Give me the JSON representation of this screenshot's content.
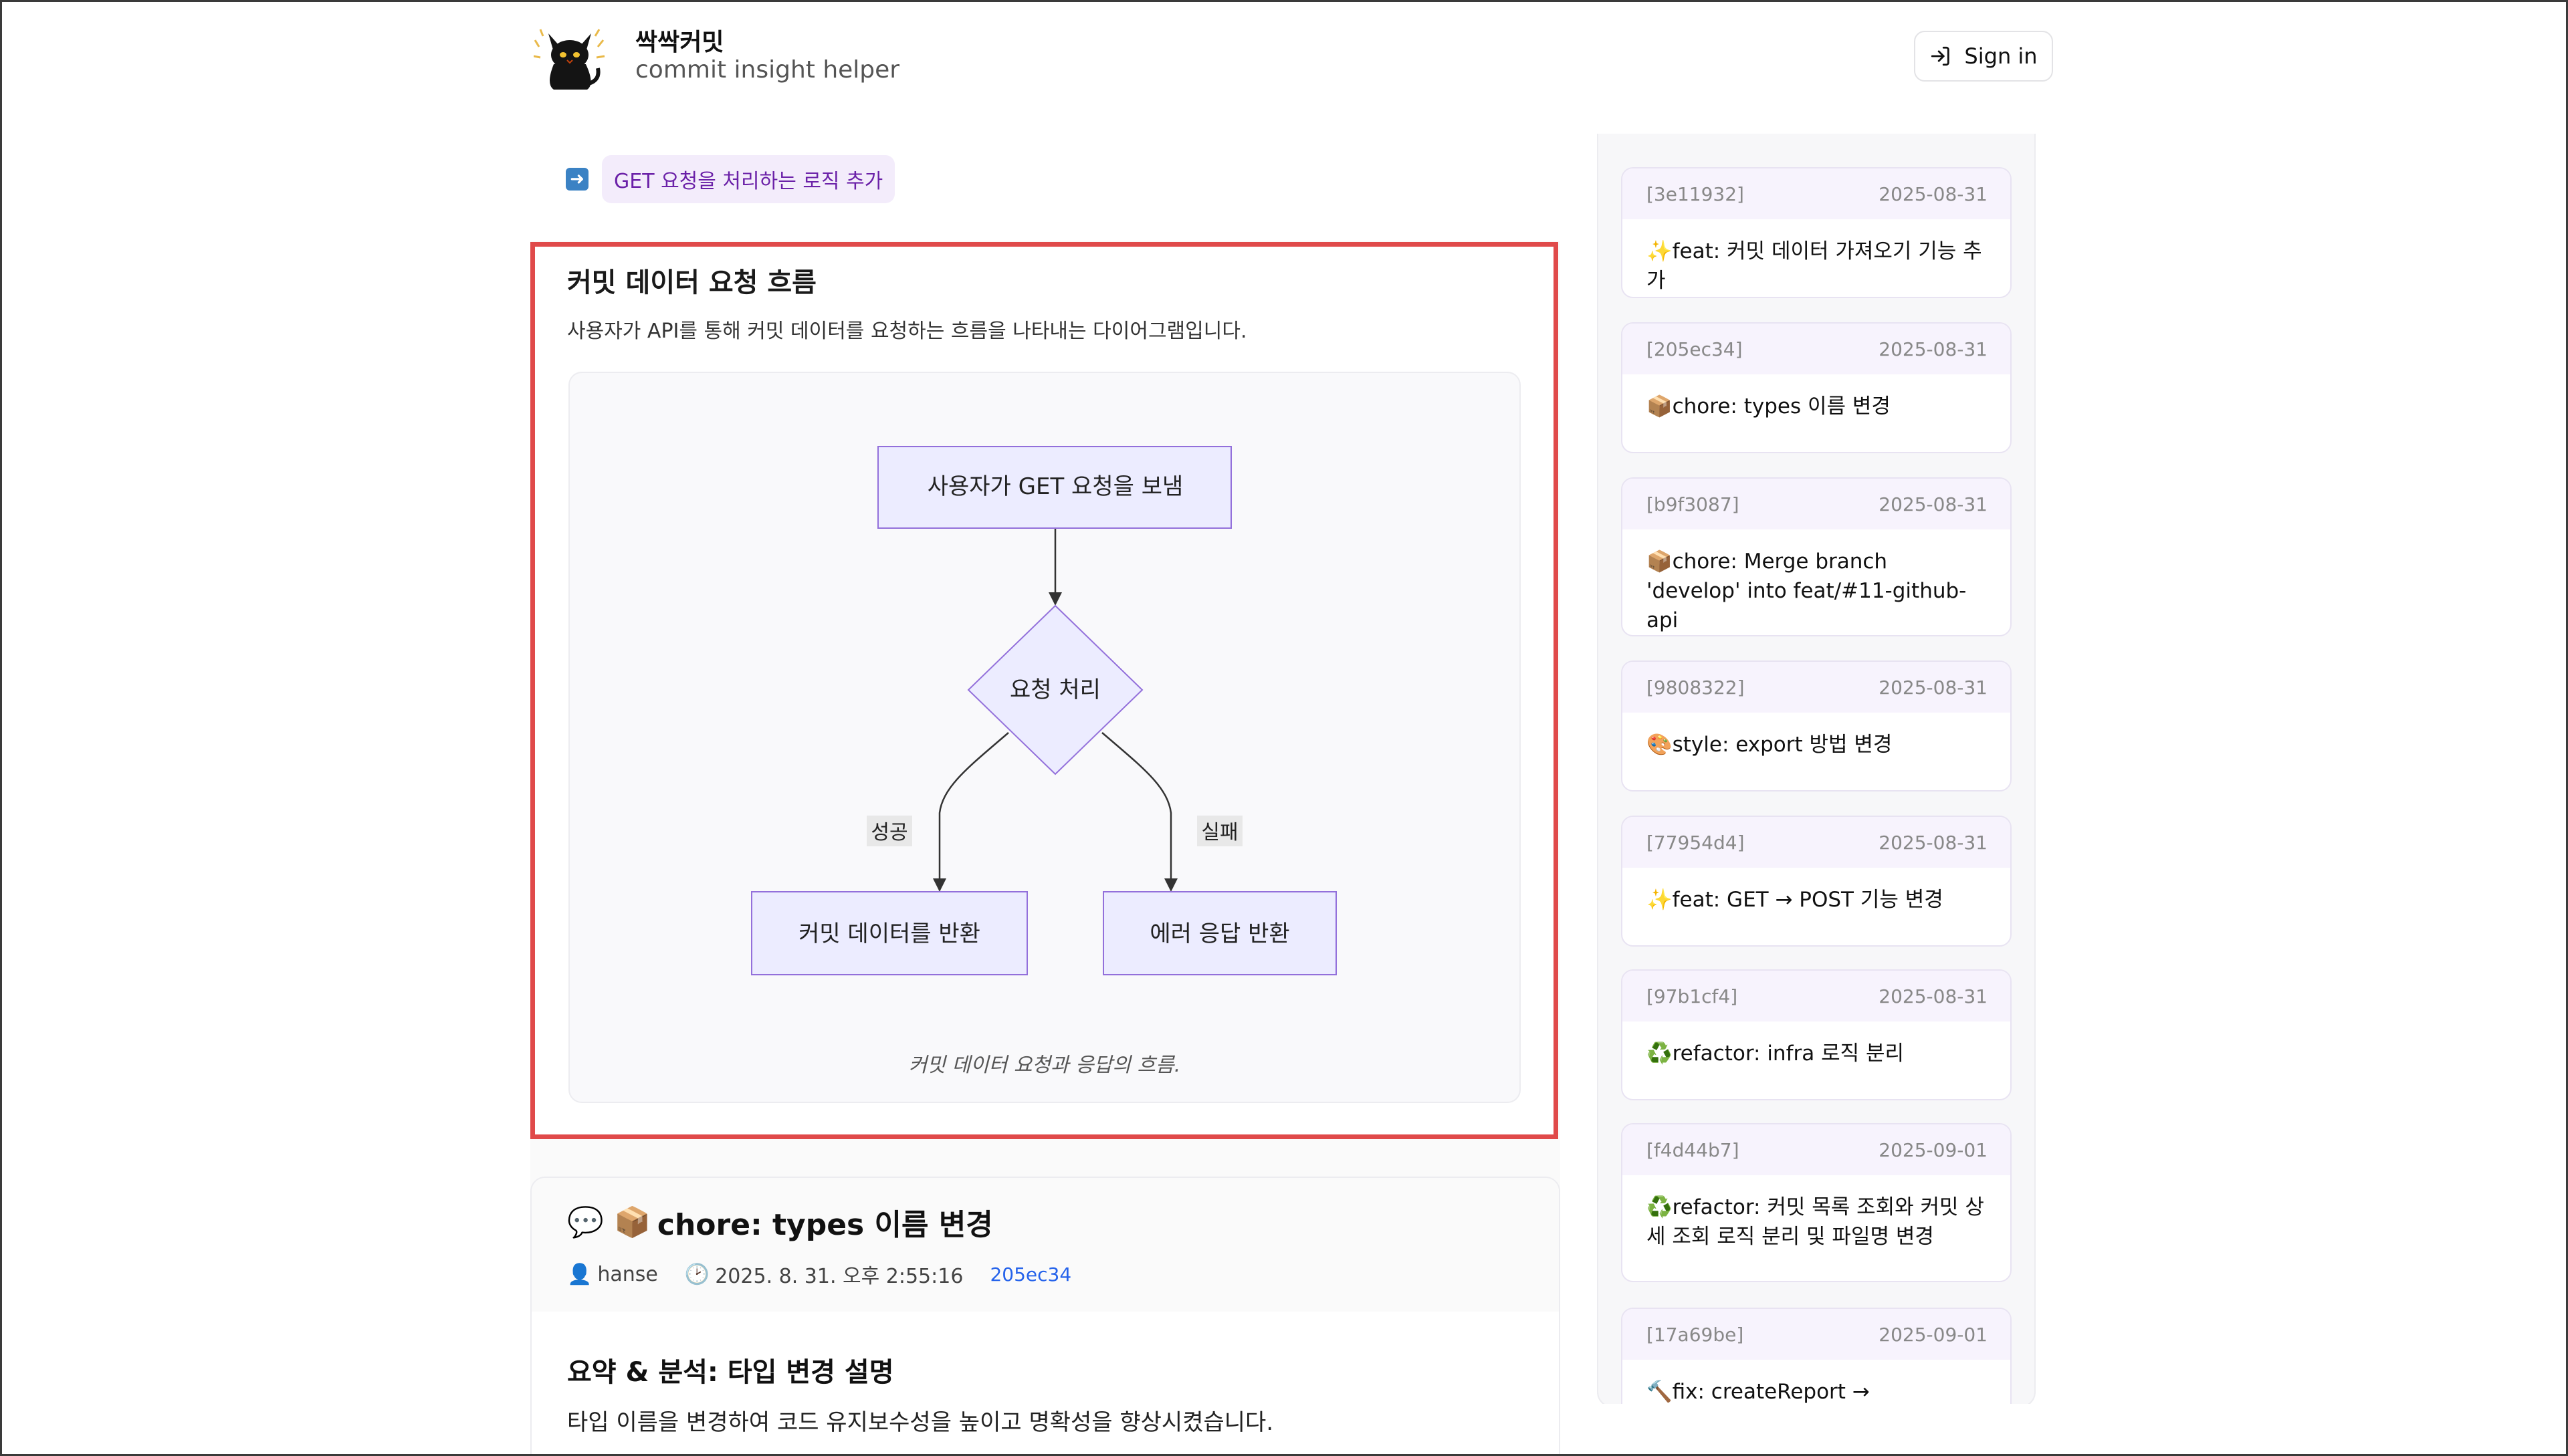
{
  "header": {
    "brand_name": "싹싹커밋",
    "brand_subtitle": "commit insight helper",
    "signin_label": "Sign in"
  },
  "main": {
    "tag": {
      "icon": "arrow-right-icon",
      "label": "GET 요청을 처리하는 로직 추가"
    },
    "section": {
      "title": "커밋 데이터 요청 흐름",
      "description": "사용자가 API를 통해 커밋 데이터를 요청하는 흐름을 나타내는 다이어그램입니다.",
      "diagram": {
        "start_node": "사용자가 GET 요청을 보냄",
        "decision_node": "요청 처리",
        "success_label": "성공",
        "failure_label": "실패",
        "success_node": "커밋 데이터를 반환",
        "failure_node": "에러 응답 반환"
      },
      "caption": "커밋 데이터 요청과 응답의 흐름."
    },
    "next_commit": {
      "icon_prefix": "💬 📦",
      "title": "chore: types 이름 변경",
      "author": "hanse",
      "datetime": "2025. 8. 31. 오후 2:55:16",
      "hash": "205ec34",
      "summary_title": "요약 & 분석: 타입 변경 설명",
      "summary_text": "타입 이름을 변경하여 코드 유지보수성을 높이고 명확성을 향상시켰습니다."
    }
  },
  "sidebar": {
    "commits": [
      {
        "hash": "[3e11932]",
        "date": "2025-08-31",
        "emoji": "✨",
        "message": "feat: 커밋 데이터 가져오기 기능 추가"
      },
      {
        "hash": "[205ec34]",
        "date": "2025-08-31",
        "emoji": "📦",
        "message": "chore: types 이름 변경"
      },
      {
        "hash": "[b9f3087]",
        "date": "2025-08-31",
        "emoji": "📦",
        "message": "chore: Merge branch 'develop' into feat/#11-github-api"
      },
      {
        "hash": "[9808322]",
        "date": "2025-08-31",
        "emoji": "🎨",
        "message": "style: export 방법 변경"
      },
      {
        "hash": "[77954d4]",
        "date": "2025-08-31",
        "emoji": "✨",
        "message": "feat: GET → POST 기능 변경"
      },
      {
        "hash": "[97b1cf4]",
        "date": "2025-08-31",
        "emoji": "♻️",
        "message": "refactor: infra 로직 분리"
      },
      {
        "hash": "[f4d44b7]",
        "date": "2025-09-01",
        "emoji": "♻️",
        "message": "refactor: 커밋 목록 조회와 커밋 상세 조회 로직 분리 및 파일명 변경"
      },
      {
        "hash": "[17a69be]",
        "date": "2025-09-01",
        "emoji": "🔨",
        "message": "fix: createReport →"
      }
    ]
  },
  "colors": {
    "highlight": "#e04a4a",
    "node_fill": "#ececff",
    "node_stroke": "#9370db",
    "tag_text": "#6b21a8",
    "hash_link": "#2563eb"
  }
}
